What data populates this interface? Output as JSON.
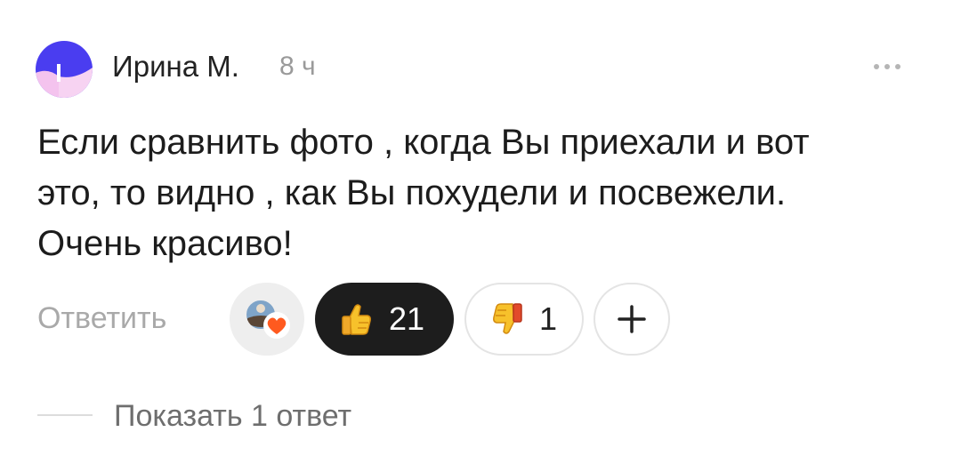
{
  "comment": {
    "author": "Ирина М.",
    "time": "8 ч",
    "text": "Если сравнить фото , когда Вы приехали и вот\nэто, то видно , как Вы похудели и посвежели.\nОчень красиво!",
    "more_icon": "more-horizontal-icon",
    "avatar_colors": {
      "top": "#4a3df0",
      "bottom": "#f4c3ee"
    }
  },
  "actions": {
    "reply_label": "Ответить",
    "reactions": [
      {
        "icon": "thumbs-up-icon",
        "count": "21",
        "selected": true
      },
      {
        "icon": "thumbs-down-icon",
        "count": "1",
        "selected": false
      }
    ],
    "add_reaction_icon": "plus-icon",
    "reactors_icon": "heart-icon"
  },
  "replies": {
    "show_label": "Показать 1 ответ"
  },
  "colors": {
    "selected_pill": "#1d1d1d",
    "muted_text": "#a9a9a9",
    "heart": "#ff5a1f"
  }
}
